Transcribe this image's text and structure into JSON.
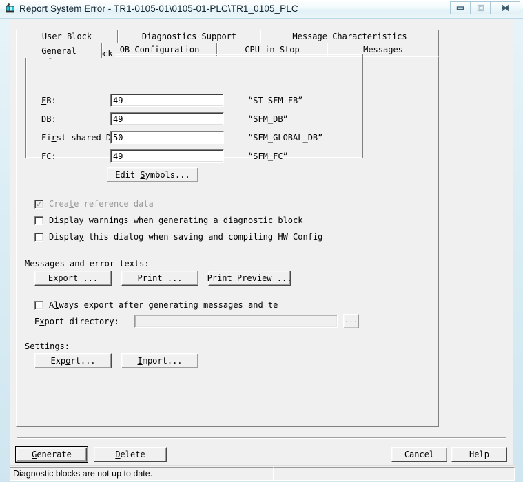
{
  "window": {
    "title": "Report System Error - TR1-0105-01\\0105-01-PLC\\TR1_0105_PLC",
    "icon": "plc-module-icon",
    "caption_buttons": {
      "minimize": "minimize-icon",
      "maximize": "maximize-icon",
      "close": "close-icon"
    }
  },
  "tabs": {
    "row_top": [
      {
        "label": "User Block",
        "selected": false
      },
      {
        "label": "Diagnostics Support",
        "selected": false
      },
      {
        "label": "Message Characteristics",
        "selected": false
      }
    ],
    "row_bottom": [
      {
        "label": "General",
        "selected": true
      },
      {
        "label": "OB Configuration",
        "selected": false
      },
      {
        "label": "CPU in Stop",
        "selected": false
      },
      {
        "label": "Messages",
        "selected": false
      }
    ]
  },
  "diagnostic_block": {
    "legend": "Diagnostic Block",
    "fields": [
      {
        "label": "FB:",
        "accel": "F",
        "value": "49",
        "symbol": "“ST_SFM_FB”"
      },
      {
        "label": "DB:",
        "accel": "B",
        "value": "49",
        "symbol": "“SFM_DB”"
      },
      {
        "label": "First shared DB:",
        "accel": "r",
        "value": "50",
        "symbol": "“SFM_GLOBAL_DB”"
      },
      {
        "label": "FC:",
        "accel": "C",
        "value": "49",
        "symbol": "“SFM_FC”"
      }
    ],
    "edit_symbols_button": "Edit Symbols..."
  },
  "options": [
    {
      "label": "Create reference data",
      "checked": true,
      "disabled": true
    },
    {
      "label": "Display warnings when generating a diagnostic block",
      "checked": false,
      "disabled": false
    },
    {
      "label": "Display this dialog when saving and compiling HW Config",
      "checked": false,
      "disabled": false
    }
  ],
  "messages_section": {
    "title": "Messages and error texts:",
    "buttons": [
      {
        "label": "Export ..."
      },
      {
        "label": "Print ..."
      },
      {
        "label": "Print Preview ..."
      }
    ],
    "always_export": {
      "label": "Always export after generating messages and te",
      "checked": false
    },
    "export_directory": {
      "label": "Export directory:",
      "value": "",
      "disabled": true,
      "browse_button": "..."
    }
  },
  "settings_section": {
    "title": "Settings:",
    "buttons": [
      {
        "label": "Export..."
      },
      {
        "label": "Import..."
      }
    ]
  },
  "dialog_buttons": {
    "left": [
      {
        "label": "Generate",
        "default": true
      },
      {
        "label": "Delete",
        "default": false
      }
    ],
    "right": [
      {
        "label": "Cancel",
        "default": false
      },
      {
        "label": "Help",
        "default": false
      }
    ]
  },
  "statusbar": {
    "message": "Diagnostic blocks are not up to date.",
    "pane2": ""
  }
}
